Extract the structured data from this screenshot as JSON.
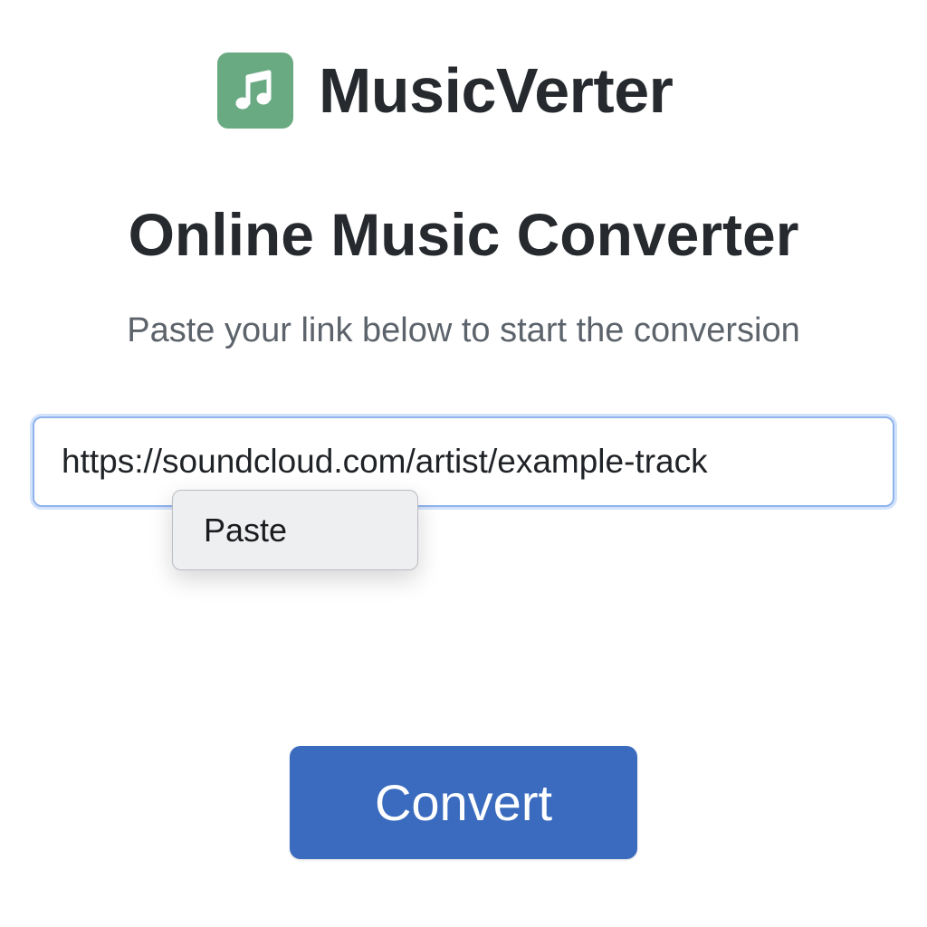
{
  "brand": {
    "name": "MusicVerter",
    "logo_icon": "music-note-icon",
    "logo_color": "#6aaa82"
  },
  "main": {
    "title": "Online Music Converter",
    "subtitle": "Paste your link below to start the conversion"
  },
  "url_field": {
    "value": "https://soundcloud.com/artist/example-track",
    "focus_color": "#8fb4ec"
  },
  "context_menu": {
    "items": [
      {
        "label": "Paste"
      }
    ]
  },
  "convert_button": {
    "label": "Convert",
    "color": "#3a6bbe"
  }
}
